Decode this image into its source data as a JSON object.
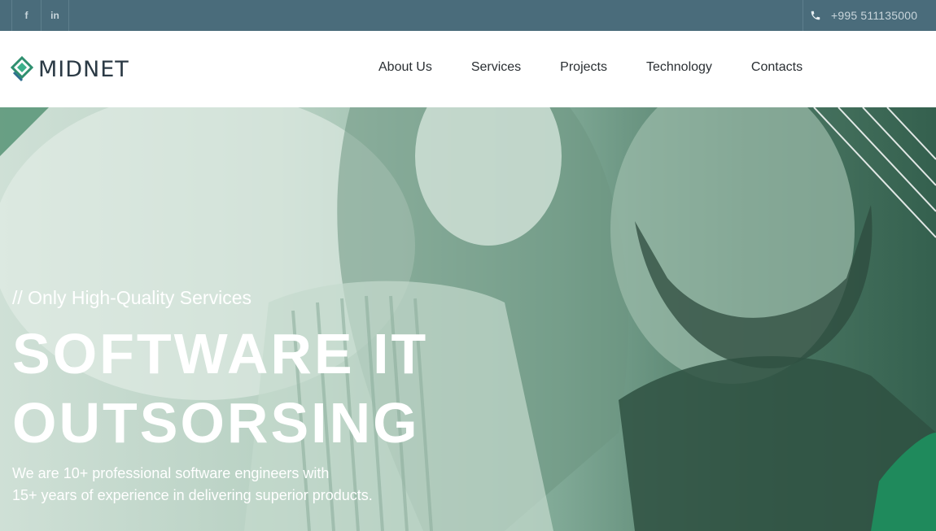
{
  "topbar": {
    "social": [
      {
        "icon": "facebook-icon",
        "label": "f"
      },
      {
        "icon": "linkedin-icon",
        "label": "in"
      }
    ],
    "phone": "+995 511135000"
  },
  "header": {
    "logo_text": "MIDNET",
    "nav": [
      "About Us",
      "Services",
      "Projects",
      "Technology",
      "Contacts"
    ]
  },
  "hero": {
    "subtitle": "// Only High-Quality Services",
    "title_line1": "SOFTWARE IT",
    "title_line2": "OUTSORSING",
    "description_line1": "We are 10+ professional software engineers with",
    "description_line2": "15+ years of experience in delivering superior products."
  },
  "colors": {
    "topbar": "#4a6c7b",
    "accent_green": "#1f8a5c",
    "text_dark": "#2a2f33"
  }
}
